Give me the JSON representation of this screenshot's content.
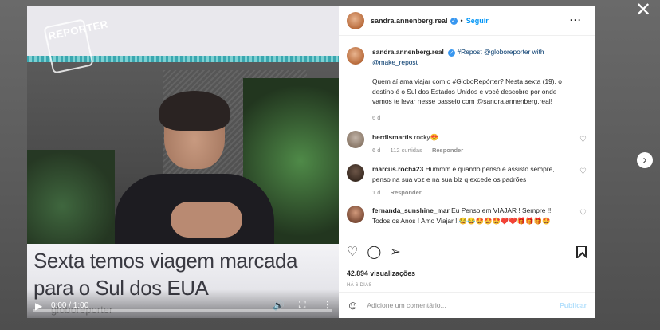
{
  "header": {
    "username": "sandra.annenberg.real",
    "verified_mark": "✓",
    "follow_label": "Seguir",
    "more_label": "···"
  },
  "close_label": "✕",
  "next_label": "›",
  "video": {
    "logo_text": "REPORTER",
    "caption": "Sexta temos viagem marcada para o Sul dos EUA",
    "watermark": "globoreporter",
    "time": "0:00 / 1:00",
    "progress": 0.0
  },
  "caption_post": {
    "username": "sandra.annenberg.real",
    "verified_mark": "✓",
    "repost_text": "#Repost @globoreporter with @make_repost",
    "body": "Quem aí ama viajar com o #GloboRepórter? Nesta sexta (19), o destino é o Sul dos Estados Unidos e você descobre por onde vamos te levar nesse passeio com @sandra.annenberg.real!",
    "time": "6 d"
  },
  "comments": [
    {
      "username": "herdismartis",
      "text": "rocky😍",
      "time": "6 d",
      "likes": "112 curtidas",
      "reply": "Responder"
    },
    {
      "username": "marcus.rocha23",
      "text": "Hummm e quando penso e assisto sempre, penso na sua voz e na sua blz q excede os padrões",
      "time": "1 d",
      "likes": "",
      "reply": "Responder"
    },
    {
      "username": "fernanda_sunshine_mar",
      "text": "Eu Penso em VIAJAR ! Sempre !!! Todos os Anos ! Amo Viajar !!😂😂🤩🤩🤩❤️❤️🎁🎁🎁🤩",
      "time": "",
      "likes": "",
      "reply": ""
    }
  ],
  "actions": {
    "views": "42.894 visualizações",
    "age": "HÁ 6 DIAS"
  },
  "composer": {
    "placeholder": "Adicione um comentário...",
    "post_label": "Publicar"
  },
  "icons": {
    "heart": "heart-icon",
    "comment": "comment-icon",
    "share": "share-icon",
    "save": "bookmark-icon",
    "emoji": "emoji-icon"
  },
  "colors": {
    "accent": "#0095f6",
    "verified": "#3897f0",
    "muted": "#8e8e8e"
  }
}
